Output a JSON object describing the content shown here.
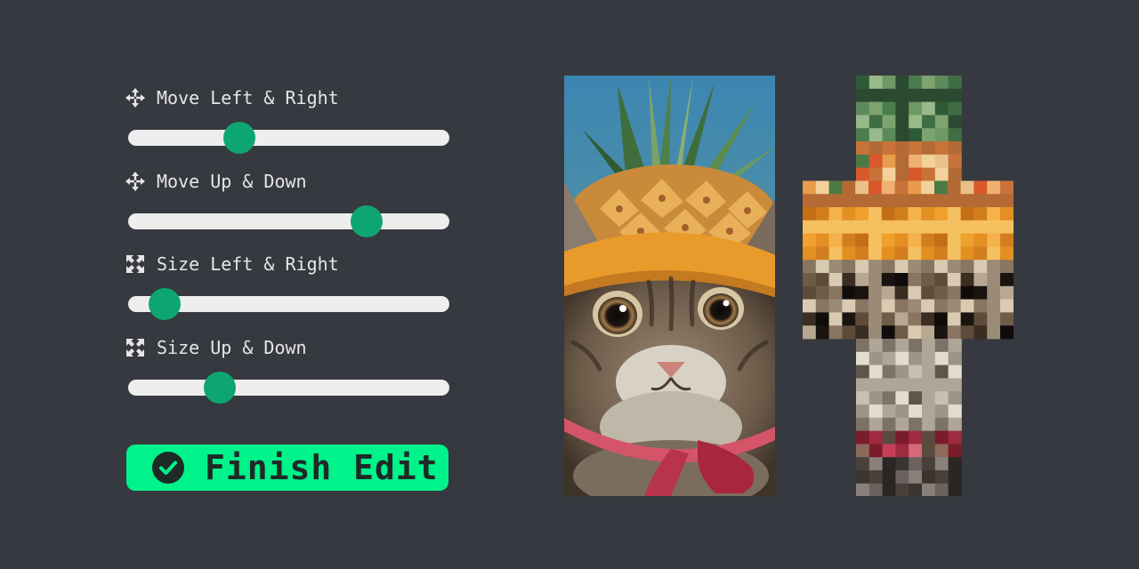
{
  "controls": [
    {
      "label": "Move Left & Right",
      "icon": "move-arrows-icon",
      "value": 0.33
    },
    {
      "label": "Move Up & Down",
      "icon": "move-arrows-icon",
      "value": 0.77
    },
    {
      "label": "Size Left & Right",
      "icon": "resize-arrows-icon",
      "value": 0.07
    },
    {
      "label": "Size Up & Down",
      "icon": "resize-arrows-icon",
      "value": 0.26
    }
  ],
  "finish_button": {
    "label": "Finish Edit",
    "icon": "check-circle-icon"
  },
  "colors": {
    "background": "#36393f",
    "slider_track": "#eeeeee",
    "slider_thumb": "#0ea670",
    "button": "#00f28a"
  }
}
